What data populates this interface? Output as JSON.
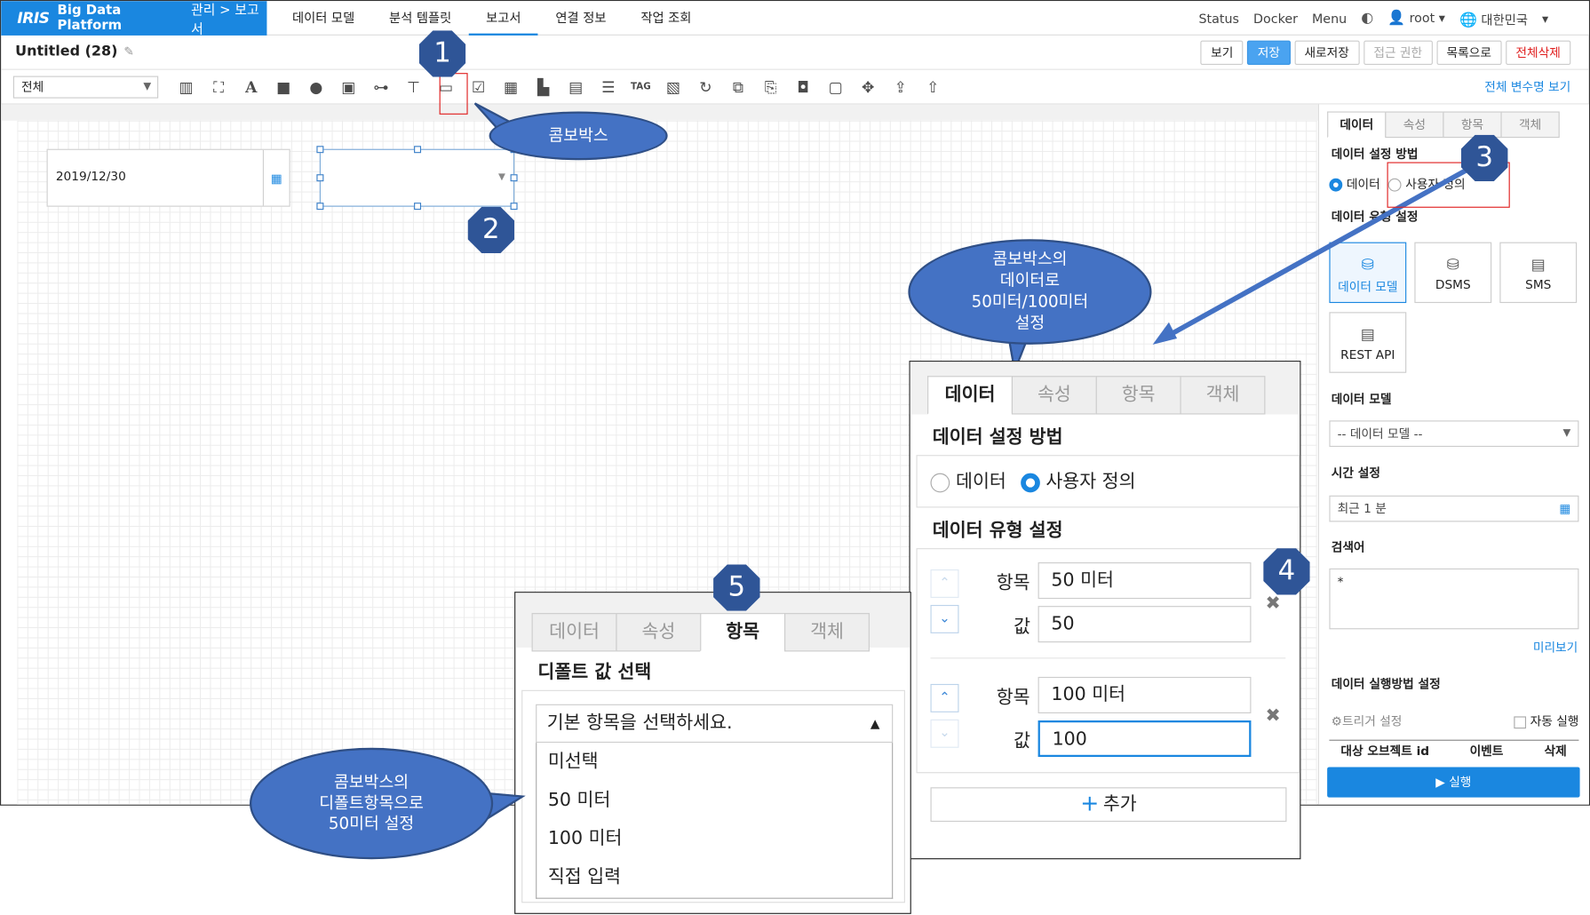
{
  "topbar": {
    "logo": "IRIS",
    "platform": "Big Data Platform",
    "breadcrumb": "관리 > 보고서",
    "nav": [
      "데이터 모델",
      "분석 템플릿",
      "보고서",
      "연결 정보",
      "작업 조회"
    ],
    "active_nav": "보고서",
    "right": {
      "status": "Status",
      "docker": "Docker",
      "menu": "Menu",
      "user": "root",
      "locale": "대한민국"
    }
  },
  "document": {
    "title": "Untitled (28)",
    "actions": [
      "보기",
      "저장",
      "새로저장",
      "접근 권한",
      "목록으로",
      "전체삭제"
    ]
  },
  "toolbar": {
    "scope_select": "전체",
    "tool_icons": [
      "bar-chart",
      "map",
      "text",
      "rectangle",
      "ellipse",
      "image",
      "label",
      "textbox",
      "combobox",
      "checkbox",
      "date",
      "folder",
      "window",
      "list",
      "tag",
      "calendar",
      "refresh",
      "image-link",
      "html",
      "frame",
      "box",
      "move",
      "upload",
      "export"
    ],
    "var_link": "전체 변수명 보기"
  },
  "canvas": {
    "date_value": "2019/12/30"
  },
  "side_panel": {
    "tabs": [
      "데이터",
      "속성",
      "항목",
      "객체"
    ],
    "active_tab": "데이터",
    "setting_method_label": "데이터 설정 방법",
    "radio_data": "데이터",
    "radio_custom": "사용자 정의",
    "type_label": "데이터 유형 설정",
    "types": [
      "데이터 모델",
      "DSMS",
      "SMS",
      "REST API"
    ],
    "model_label": "데이터 모델",
    "model_placeholder": "-- 데이터 모델 --",
    "time_label": "시간 설정",
    "time_value": "최근 1 분",
    "search_label": "검색어",
    "search_value": "*",
    "preview": "미리보기",
    "exec_label": "데이터 실행방법 설정",
    "trigger": "트리거 설정",
    "auto_run": "자동 실행",
    "table_headers": [
      "대상 오브젝트 id",
      "이벤트",
      "삭제"
    ],
    "run": "▶ 실행"
  },
  "callouts": {
    "combobox": "콤보박스",
    "data_note": [
      "콤보박스의",
      "데이터로",
      "50미터/100미터",
      "설정"
    ],
    "default_note": [
      "콤보박스의",
      "디폴트항목으로",
      "50미터 설정"
    ],
    "markers": [
      "1",
      "2",
      "3",
      "4",
      "5"
    ]
  },
  "zoom_data_panel": {
    "tabs": [
      "데이터",
      "속성",
      "항목",
      "객체"
    ],
    "setting_method_label": "데이터 설정 방법",
    "radio_data": "데이터",
    "radio_custom": "사용자 정의",
    "type_label": "데이터 유형 설정",
    "item_label": "항목",
    "value_label": "값",
    "rows": [
      {
        "item": "50 미터",
        "value": "50"
      },
      {
        "item": "100 미터",
        "value": "100"
      }
    ],
    "add": "추가"
  },
  "zoom_items_panel": {
    "tabs": [
      "데이터",
      "속성",
      "항목",
      "객체"
    ],
    "default_label": "디폴트 값 선택",
    "dropdown_value": "기본 항목을 선택하세요.",
    "options": [
      "미선택",
      "50 미터",
      "100 미터",
      "직접 입력"
    ]
  },
  "colors": {
    "brand": "#1a87e0",
    "marker": "#2f5597",
    "callout": "#4472c4",
    "highlight": "#e02020"
  }
}
